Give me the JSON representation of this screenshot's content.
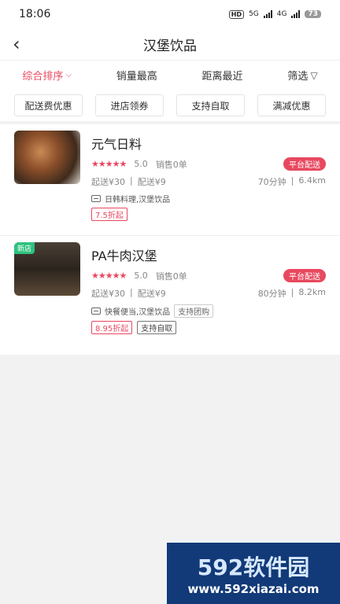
{
  "status": {
    "time": "18:06",
    "hd": "HD",
    "net1": "5G",
    "net2": "4G",
    "battery": "73"
  },
  "nav": {
    "title": "汉堡饮品"
  },
  "sort": [
    {
      "label": "综合排序"
    },
    {
      "label": "销量最高"
    },
    {
      "label": "距离最近"
    },
    {
      "label": "筛选"
    }
  ],
  "filters": [
    "配送费优惠",
    "进店领券",
    "支持自取",
    "满减优惠"
  ],
  "stores": [
    {
      "name": "元气日料",
      "stars": "★★★★★",
      "score": "5.0",
      "sales": "销售0单",
      "delivery_badge": "平台配送",
      "min_order": "起送¥30",
      "delivery_fee": "配送¥9",
      "time": "70分钟",
      "distance": "6.4km",
      "categories": "日韩料理,汉堡饮品",
      "discount": "7.5折起"
    },
    {
      "badge": "新店",
      "name": "PA牛肉汉堡",
      "stars": "★★★★★",
      "score": "5.0",
      "sales": "销售0单",
      "delivery_badge": "平台配送",
      "min_order": "起送¥30",
      "delivery_fee": "配送¥9",
      "time": "80分钟",
      "distance": "8.2km",
      "categories": "快餐便当,汉堡饮品",
      "extra_tag": "支持团购",
      "discount": "8.95折起",
      "pickup_tag": "支持自取"
    }
  ],
  "watermark": {
    "logo": "592软件园",
    "url": "www.592xiazai.com"
  }
}
